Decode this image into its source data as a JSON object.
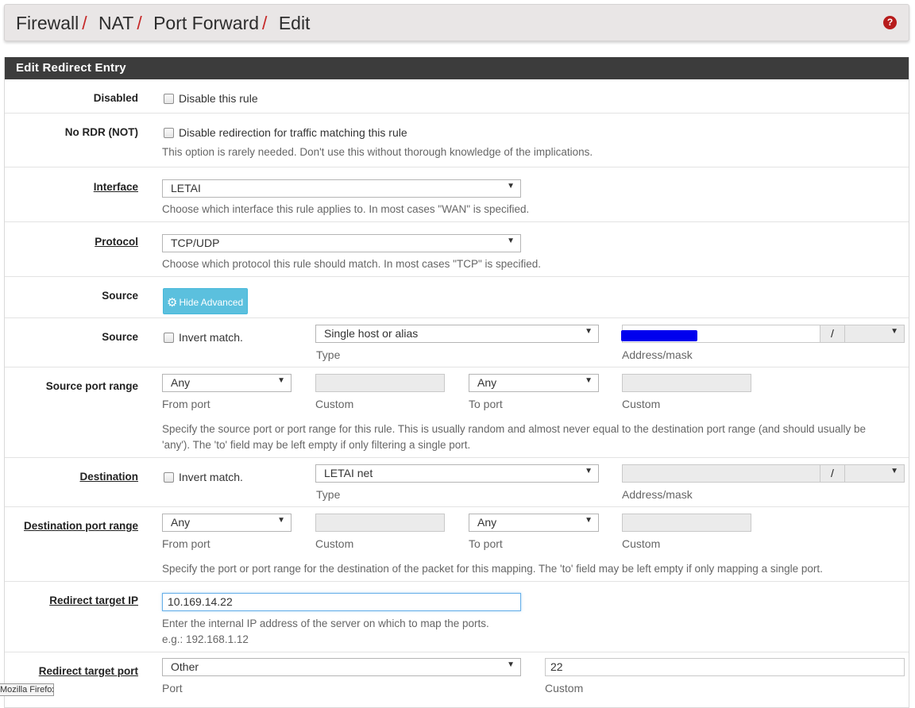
{
  "breadcrumb": [
    "Firewall",
    "NAT",
    "Port Forward",
    "Edit"
  ],
  "panel_title": "Edit Redirect Entry",
  "disabled": {
    "label": "Disabled",
    "checkbox_text": "Disable this rule"
  },
  "nordr": {
    "label": "No RDR (NOT)",
    "checkbox_text": "Disable redirection for traffic matching this rule",
    "help": "This option is rarely needed. Don't use this without thorough knowledge of the implications."
  },
  "interface": {
    "label": "Interface",
    "value": "LETAI",
    "help": "Choose which interface this rule applies to. In most cases \"WAN\" is specified."
  },
  "protocol": {
    "label": "Protocol",
    "value": "TCP/UDP",
    "help": "Choose which protocol this rule should match. In most cases \"TCP\" is specified."
  },
  "source_adv": {
    "label": "Source",
    "button": "Hide Advanced"
  },
  "source": {
    "label": "Source",
    "invert_text": "Invert match.",
    "type_value": "Single host or alias",
    "type_caption": "Type",
    "address_caption": "Address/mask",
    "slash": "/"
  },
  "source_port": {
    "label": "Source port range",
    "from_value": "Any",
    "from_caption": "From port",
    "custom_caption": "Custom",
    "to_value": "Any",
    "to_caption": "To port",
    "help": "Specify the source port or port range for this rule. This is usually random and almost never equal to the destination port range (and should usually be",
    "help2": "'any'). The 'to' field may be left empty if only filtering a single port."
  },
  "destination": {
    "label": "Destination",
    "invert_text": "Invert match.",
    "type_value": "LETAI net",
    "type_caption": "Type",
    "address_caption": "Address/mask",
    "slash": "/"
  },
  "dest_port": {
    "label": "Destination port range",
    "from_value": "Any",
    "from_caption": "From port",
    "custom_caption": "Custom",
    "to_value": "Any",
    "to_caption": "To port",
    "help": "Specify the port or port range for the destination of the packet for this mapping. The 'to' field may be left empty if only mapping a single port."
  },
  "redirect_ip": {
    "label": "Redirect target IP",
    "value": "10.169.14.22",
    "help": "Enter the internal IP address of the server on which to map the ports.",
    "example": "e.g.: 192.168.1.12"
  },
  "redirect_port": {
    "label": "Redirect target port",
    "select_value": "Other",
    "custom_value": "22",
    "port_caption": "Port",
    "custom_caption": "Custom"
  },
  "tooltip": "Mozilla Firefox",
  "colors": {
    "header_bg": "#3c3c3c",
    "accent_red": "#c62828",
    "info_button": "#5bc0de"
  }
}
